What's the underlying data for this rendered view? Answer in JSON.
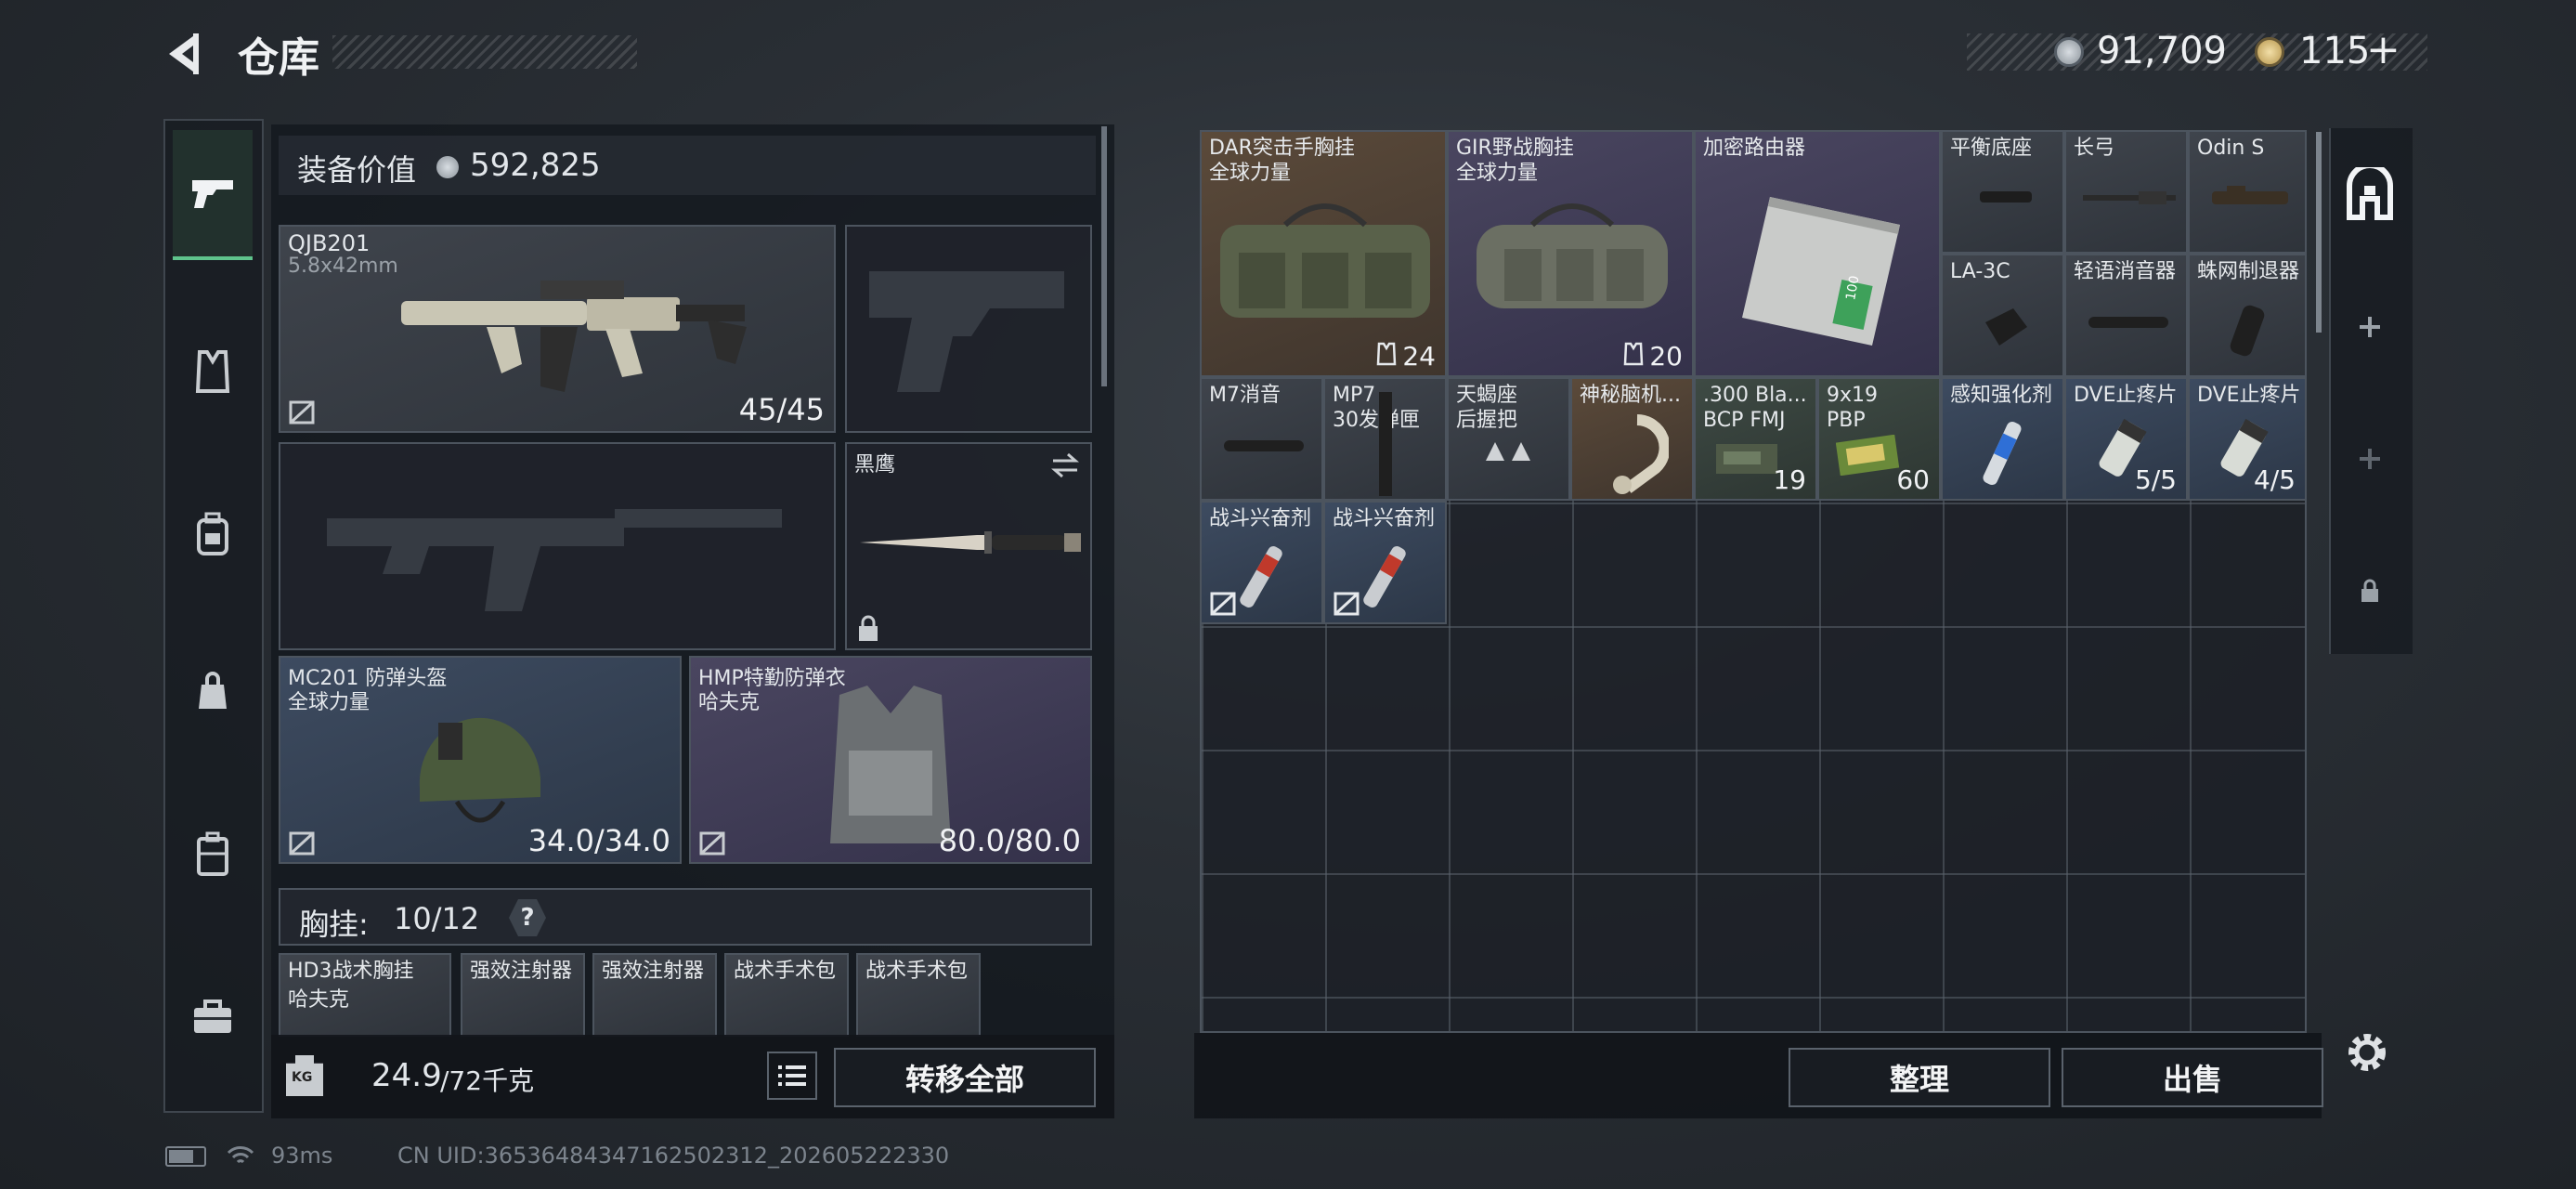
{
  "header": {
    "title": "仓库",
    "currency1": "91,709",
    "currency2": "115",
    "plus": "+"
  },
  "loadout": {
    "value_label": "装备价值",
    "value": "592,825",
    "primary": {
      "name": "QJB201",
      "ammo": "5.8x42mm",
      "durability": "45/45"
    },
    "knife": {
      "name": "黑鹰"
    },
    "helmet": {
      "name": "MC201 防弹头盔",
      "brand": "全球力量",
      "durability": "34.0/34.0"
    },
    "armor": {
      "name": "HMP特勤防弹衣",
      "brand": "哈夫克",
      "durability": "80.0/80.0"
    },
    "chest_rig": {
      "label": "胸挂:",
      "count": "10/12",
      "help": "?"
    },
    "rig_items": [
      {
        "name": "HD3战术胸挂",
        "brand": "哈夫克"
      },
      {
        "name": "强效注射器"
      },
      {
        "name": "强效注射器"
      },
      {
        "name": "战术手术包"
      },
      {
        "name": "战术手术包"
      }
    ],
    "weight": {
      "current": "24.9",
      "max": "/72千克",
      "icon": "KG"
    },
    "transfer_all": "转移全部"
  },
  "stash": {
    "items": [
      {
        "label": "DAR突击手胸挂\n全球力量",
        "count": "24"
      },
      {
        "label": "GIR野战胸挂\n全球力量",
        "count": "20"
      },
      {
        "label": "加密路由器",
        "count": "",
        "badge": "100"
      },
      {
        "label": "平衡底座",
        "count": ""
      },
      {
        "label": "长弓",
        "count": ""
      },
      {
        "label": "Odin S",
        "count": ""
      },
      {
        "label": "LA-3C",
        "count": ""
      },
      {
        "label": "轻语消音器",
        "count": ""
      },
      {
        "label": "蛛网制退器",
        "count": ""
      },
      {
        "label": "M7消音",
        "count": ""
      },
      {
        "label": "MP7\n30发弹匣",
        "count": ""
      },
      {
        "label": "天蝎座\n后握把",
        "count": ""
      },
      {
        "label": "神秘脑机...",
        "count": ""
      },
      {
        "label": ".300 Bla...\nBCP FMJ",
        "count": "19"
      },
      {
        "label": "9x19\nPBP",
        "count": "60"
      },
      {
        "label": "感知强化剂",
        "count": ""
      },
      {
        "label": "DVE止疼片",
        "count": "5/5"
      },
      {
        "label": "DVE止疼片",
        "count": "4/5"
      },
      {
        "label": "战斗兴奋剂",
        "count": ""
      },
      {
        "label": "战斗兴奋剂",
        "count": ""
      }
    ],
    "sort_button": "整理",
    "sell_button": "出售"
  },
  "status": {
    "ping": "93ms",
    "uid": "CN UID:3653648434716250231​2_202605222330"
  },
  "colors": {
    "bg": "#23282e",
    "cell_border": "#4c545e",
    "accent": "#d9c59a",
    "active_tab": "#5fc48c"
  },
  "icons": [
    "back-arrow-icon",
    "silver-coin-icon",
    "gold-coin-icon",
    "pistol-icon",
    "vest-icon",
    "backpack-icon",
    "pouch-icon",
    "case-icon",
    "toolbox-icon",
    "stash-tab-icon",
    "plus-icon",
    "lock-icon",
    "settings-icon",
    "list-icon",
    "kg-icon",
    "battery-icon",
    "wifi-icon"
  ]
}
